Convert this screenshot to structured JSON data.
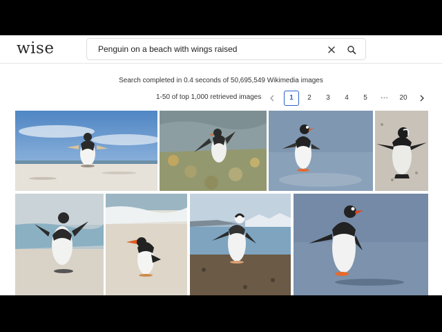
{
  "app": {
    "logo": "wise"
  },
  "search": {
    "query": "Penguin on a beach with wings raised"
  },
  "status": {
    "text": "Search completed in 0.4 seconds of 50,695,549 Wikimedia images"
  },
  "pagination": {
    "count_text": "1-50 of top 1,000 retrieved images",
    "pages": [
      "1",
      "2",
      "3",
      "4",
      "5"
    ],
    "ellipsis": "•••",
    "last": "20",
    "current": "1"
  },
  "results": [
    {
      "name": "penguin-1",
      "subject": "penguin standing on beach with wings out, blue sky"
    },
    {
      "name": "penguin-2",
      "subject": "penguin walking on rocky shore"
    },
    {
      "name": "penguin-3",
      "subject": "gentoo penguin on wet sand"
    },
    {
      "name": "penguin-4",
      "subject": "african penguin with wings spread"
    },
    {
      "name": "penguin-5",
      "subject": "african penguin facing away, wings raised"
    },
    {
      "name": "penguin-6",
      "subject": "gentoo penguin bending on sand"
    },
    {
      "name": "penguin-7",
      "subject": "chinstrap penguin on pebble beach"
    },
    {
      "name": "penguin-8",
      "subject": "gentoo penguin walking on wet sand"
    }
  ]
}
